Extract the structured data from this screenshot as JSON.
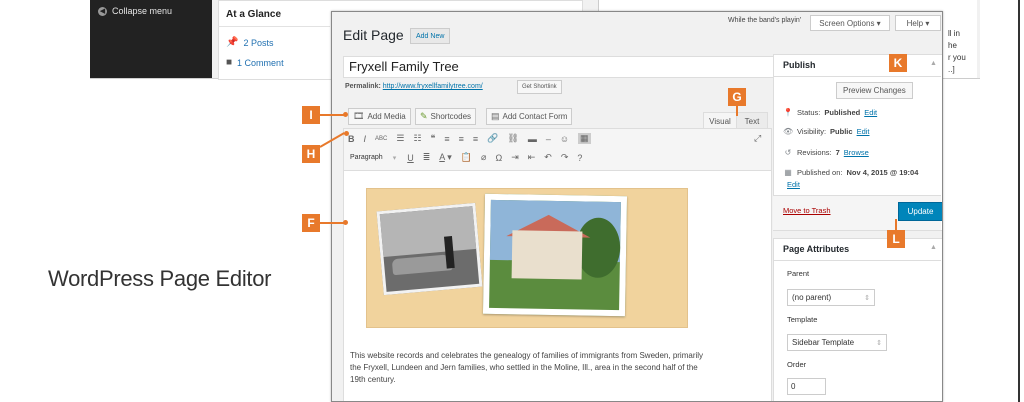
{
  "caption": "WordPress Page Editor",
  "background": {
    "collapse_menu": "Collapse menu",
    "at_a_glance": "At a Glance",
    "posts": "2 Posts",
    "comments": "1 Comment",
    "snippet": [
      "ll in",
      "he",
      "r you",
      "..]"
    ]
  },
  "top": {
    "playing": "While the band's playin'",
    "screen_options": "Screen Options ▾",
    "help": "Help ▾"
  },
  "editor": {
    "heading": "Edit Page",
    "add_new": "Add New",
    "title": "Fryxell Family Tree",
    "permalink_label": "Permalink:",
    "permalink_url": "http://www.fryxellfamilytree.com/",
    "get_shortlink": "Get Shortlink",
    "add_media": "Add Media",
    "shortcodes": "Shortcodes",
    "add_contact_form": "Add Contact Form",
    "tab_visual": "Visual",
    "tab_text": "Text",
    "format_select": "Paragraph",
    "body_text": "This website records and celebrates the genealogy of families of immigrants from Sweden, primarily the Fryxell, Lundeen and Jern families, who settled in the Moline, Ill., area in the second half of the 19th century."
  },
  "publish": {
    "title": "Publish",
    "preview": "Preview Changes",
    "status_label": "Status:",
    "status_value": "Published",
    "visibility_label": "Visibility:",
    "visibility_value": "Public",
    "revisions_label": "Revisions:",
    "revisions_value": "7",
    "published_on_label": "Published on:",
    "published_on_value": "Nov 4, 2015 @ 19:04",
    "edit": "Edit",
    "browse": "Browse",
    "move_to_trash": "Move to Trash",
    "update": "Update"
  },
  "page_attributes": {
    "title": "Page Attributes",
    "parent_label": "Parent",
    "parent_value": "(no parent)",
    "template_label": "Template",
    "template_value": "Sidebar Template",
    "order_label": "Order",
    "order_value": "0"
  },
  "callouts": {
    "f": "F",
    "g": "G",
    "h": "H",
    "i": "I",
    "k": "K",
    "l": "L"
  },
  "colors": {
    "callout": "#e8792b",
    "update_button": "#0085ba",
    "link": "#0073aa"
  }
}
